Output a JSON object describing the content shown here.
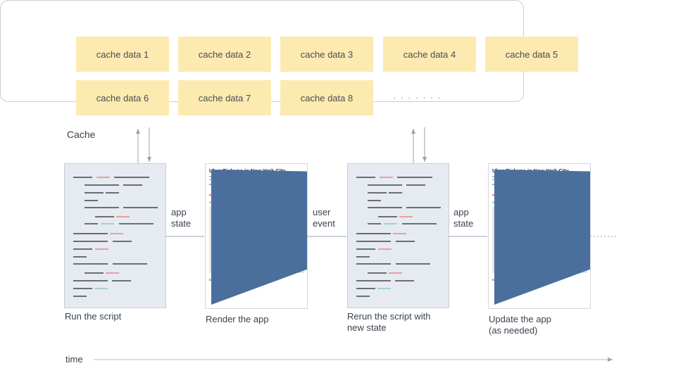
{
  "cache": {
    "label": "Cache",
    "items": [
      "cache data 1",
      "cache data 2",
      "cache data 3",
      "cache data 4",
      "cache data 5",
      "cache data 6",
      "cache data 7",
      "cache data 8"
    ],
    "more": "· · · · · · ·"
  },
  "steps": [
    {
      "caption": "Run the script"
    },
    {
      "caption": "Render the app"
    },
    {
      "caption_line1": "Rerun the script with",
      "caption_line2": "new state"
    },
    {
      "caption_line1": "Update the app",
      "caption_line2": "(as needed)"
    }
  ],
  "connectors": [
    {
      "line1": "app",
      "line2": "state"
    },
    {
      "line1": "user",
      "line2": "event"
    },
    {
      "line1": "app",
      "line2": "state"
    }
  ],
  "app": {
    "title": "Uber Pickups in New York City",
    "map_heading": "Geo data between 13:00 and 14:00",
    "chart_heading": "Breakdown by minute between 13:00 and 14:00"
  },
  "time_label": "time",
  "colors": {
    "cache_cell": "#fdeab0",
    "code_panel": "#e6eaf1",
    "code_line": "#6b6e73",
    "code_red": "#e8a0a0",
    "code_teal": "#a8cfd2",
    "chart": "#4a6f9c",
    "arrow": "#9aa0b0"
  }
}
